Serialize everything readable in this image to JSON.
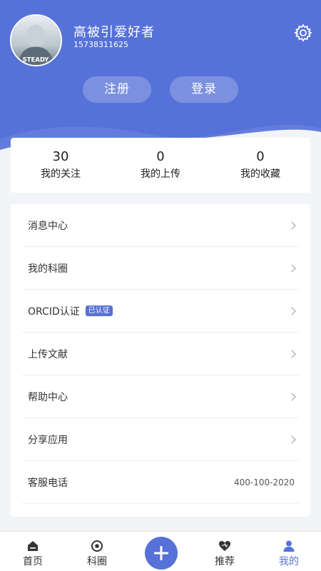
{
  "profile": {
    "username": "高被引爱好者",
    "phone": "15738311625",
    "avatar_text": "STEADY"
  },
  "auth": {
    "register_label": "注册",
    "login_label": "登录"
  },
  "stats": [
    {
      "value": "30",
      "label": "我的关注"
    },
    {
      "value": "0",
      "label": "我的上传"
    },
    {
      "value": "0",
      "label": "我的收藏"
    }
  ],
  "menu": {
    "items": [
      {
        "label": "消息中心"
      },
      {
        "label": "我的科圈"
      },
      {
        "label": "ORCID认证",
        "badge": "已认证"
      },
      {
        "label": "上传文献"
      },
      {
        "label": "帮助中心"
      },
      {
        "label": "分享应用"
      },
      {
        "label": "客服电话",
        "value": "400-100-2020"
      }
    ]
  },
  "tabbar": {
    "tabs": [
      {
        "label": "首页",
        "icon": "home-icon"
      },
      {
        "label": "科圈",
        "icon": "circle-target-icon"
      },
      {
        "label": "推荐",
        "icon": "heart-icon"
      },
      {
        "label": "我的",
        "icon": "user-icon",
        "active": true
      }
    ],
    "center_icon": "plus-icon"
  },
  "colors": {
    "accent": "#5672d8",
    "background": "#f3f4f8",
    "card": "#ffffff"
  }
}
